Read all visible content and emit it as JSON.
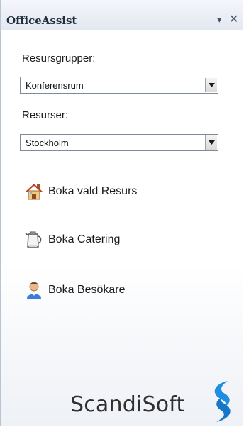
{
  "pane": {
    "title": "OfficeAssist",
    "menu_icon": "dropdown-triangle-icon",
    "menu_glyph": "▾",
    "close_icon": "close-icon",
    "close_glyph": "✕"
  },
  "form": {
    "resource_groups_label": "Resursgrupper:",
    "resource_group_value": "Konferensrum",
    "resources_label": "Resurser:",
    "resource_value": "Stockholm"
  },
  "actions": {
    "book_resource": {
      "label": "Boka vald Resurs",
      "icon": "house-icon"
    },
    "book_catering": {
      "label": "Boka Catering",
      "icon": "coffee-pot-icon"
    },
    "book_visitor": {
      "label": "Boka Besökare",
      "icon": "visitor-icon"
    }
  },
  "branding": {
    "text": "ScandiSoft",
    "logo_icon": "scandisoft-logo-icon",
    "logo_color": "#1e8fe0"
  }
}
